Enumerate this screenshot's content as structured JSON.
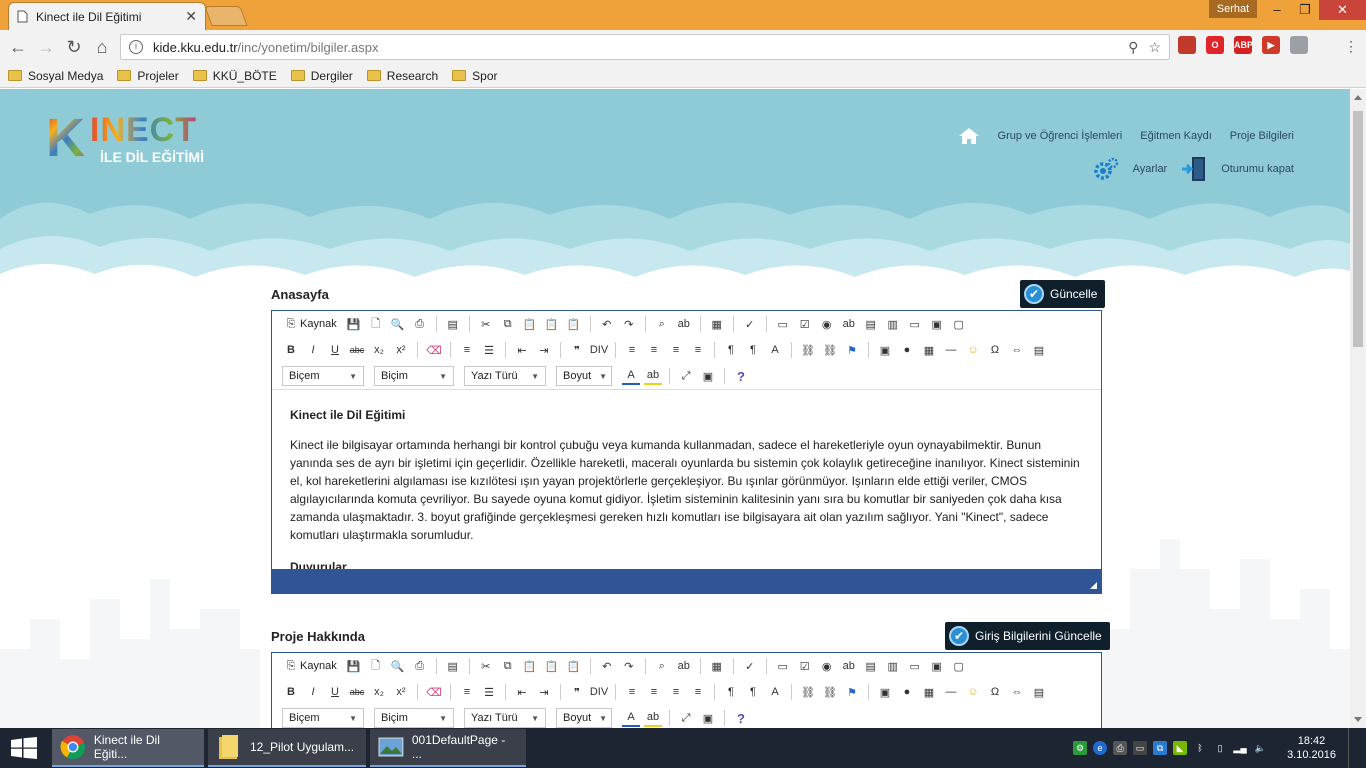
{
  "browser": {
    "tab_title": "Kinect ile Dil Eğitimi",
    "tab_close": "✕",
    "user_badge": "Serhat",
    "url_host": "kide.kku.edu.tr",
    "url_path": "/inc/yonetim/bilgiler.aspx",
    "bookmarks": [
      "Sosyal Medya",
      "Projeler",
      "KKÜ_BÖTE",
      "Dergiler",
      "Research",
      "Spor"
    ],
    "extensions": [
      {
        "name": "pdf-icon",
        "label": "",
        "color": "#c0392b"
      },
      {
        "name": "opera-icon",
        "label": "O",
        "color": "#e0242a"
      },
      {
        "name": "adblock-icon",
        "label": "ABP",
        "color": "#d22222"
      },
      {
        "name": "video-icon",
        "label": "▶",
        "color": "#d03a2a"
      },
      {
        "name": "profile-icon",
        "label": "",
        "color": "#9aa0a6"
      }
    ]
  },
  "site": {
    "logo_k": "K",
    "logo_inect": "INECT",
    "logo_sub": "İLE DİL EĞİTİMİ",
    "nav": [
      "Grup ve Öğrenci İşlemleri",
      "Eğitmen Kaydı",
      "Proje Bilgileri"
    ],
    "subnav": [
      "Ayarlar",
      "Oturumu kapat"
    ]
  },
  "sections": [
    {
      "title": "Anasayfa",
      "button": "Güncelle",
      "heading": "Kinect ile Dil Eğitimi",
      "body": "Kinect ile bilgisayar ortamında herhangi bir kontrol çubuğu veya kumanda kullanmadan, sadece el hareketleriyle oyun oynayabilmektir. Bunun yanında ses de ayrı bir işletimi için geçerlidir. Özellikle hareketli, maceralı oyunlarda bu sistemin çok kolaylık getireceğine inanılıyor. Kinect sisteminin el, kol hareketlerini algılaması ise kızılötesi ışın yayan projektörlerle gerçekleşiyor. Bu ışınlar görünmüyor. Işınların elde ettiği veriler, CMOS algılayıcılarında komuta çevriliyor. Bu sayede oyuna komut gidiyor. İşletim sisteminin kalitesinin yanı sıra bu komutlar bir saniyeden çok daha kısa zamanda ulaşmaktadır. 3. boyut grafiğinde gerçekleşmesi gereken hızlı komutları ise bilgisayara ait olan yazılım sağlıyor. Yani \"Kinect\", sadece komutları ulaştırmakla sorumludur.",
      "next_heading": "Duyurular"
    },
    {
      "title": "Proje Hakkında",
      "button": "Giriş Bilgilerini Güncelle"
    }
  ],
  "editor": {
    "source_label": "Kaynak",
    "combos": [
      "Biçem",
      "Biçim",
      "Yazı Türü",
      "Boyut"
    ]
  },
  "taskbar": {
    "tasks": [
      "Kinect ile Dil Eğiti...",
      "12_Pilot Uygulam...",
      "001DefaultPage - ..."
    ],
    "time": "18:42",
    "date": "3.10.2016"
  }
}
